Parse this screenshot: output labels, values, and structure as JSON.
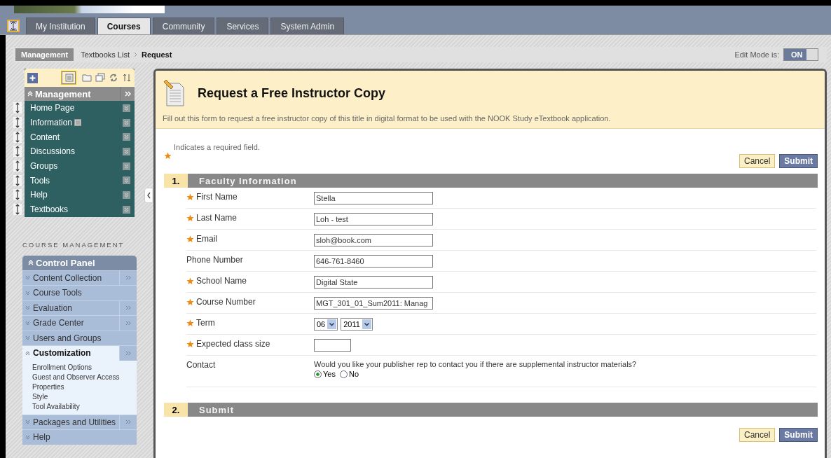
{
  "tabs": [
    {
      "label": "My Institution",
      "selected": false
    },
    {
      "label": "Courses",
      "selected": true
    },
    {
      "label": "Community",
      "selected": false
    },
    {
      "label": "Services",
      "selected": false
    },
    {
      "label": "System Admin",
      "selected": false
    }
  ],
  "breadcrumb": {
    "root": "Management",
    "items": [
      "Textbooks List",
      "Request"
    ]
  },
  "edit_mode": {
    "label": "Edit Mode is:",
    "value": "ON",
    "on": true
  },
  "course_menu": {
    "title": "Management",
    "items": [
      {
        "label": "Home Page",
        "has_page_icon": false
      },
      {
        "label": "Information",
        "has_page_icon": true
      },
      {
        "label": "Content",
        "has_page_icon": false
      },
      {
        "label": "Discussions",
        "has_page_icon": false
      },
      {
        "label": "Groups",
        "has_page_icon": false
      },
      {
        "label": "Tools",
        "has_page_icon": false
      },
      {
        "label": "Help",
        "has_page_icon": false
      },
      {
        "label": "Textbooks",
        "has_page_icon": false
      }
    ]
  },
  "course_management": {
    "heading": "COURSE MANAGEMENT",
    "panel_title": "Control Panel",
    "items": [
      {
        "label": "Content Collection",
        "expanded": false,
        "has_submenu": true
      },
      {
        "label": "Course Tools",
        "expanded": false,
        "has_submenu": false
      },
      {
        "label": "Evaluation",
        "expanded": false,
        "has_submenu": true
      },
      {
        "label": "Grade Center",
        "expanded": false,
        "has_submenu": true
      },
      {
        "label": "Users and Groups",
        "expanded": false,
        "has_submenu": false
      },
      {
        "label": "Customization",
        "expanded": true,
        "has_submenu": true,
        "children": [
          "Enrollment Options",
          "Guest and Observer Access",
          "Properties",
          "Style",
          "Tool Availability"
        ]
      },
      {
        "label": "Packages and Utilities",
        "expanded": false,
        "has_submenu": true
      },
      {
        "label": "Help",
        "expanded": false,
        "has_submenu": false
      }
    ]
  },
  "page": {
    "title": "Request a Free Instructor Copy",
    "description": "Fill out this form to request a free instructor copy of this title in digital format to be used with the NOOK Study eTextbook application.",
    "required_note": "Indicates a required field.",
    "buttons": [
      "Cancel",
      "Submit"
    ]
  },
  "sections": [
    {
      "number": "1.",
      "title": "Faculty Information",
      "fields": [
        {
          "kind": "text",
          "label": "First Name",
          "required": true,
          "value": "Stella"
        },
        {
          "kind": "text",
          "label": "Last Name",
          "required": true,
          "value": "Loh - test"
        },
        {
          "kind": "text",
          "label": "Email",
          "required": true,
          "value": "sloh@book.com"
        },
        {
          "kind": "text",
          "label": "Phone Number",
          "required": false,
          "value": "646-761-8460"
        },
        {
          "kind": "text",
          "label": "School Name",
          "required": true,
          "value": "Digital State"
        },
        {
          "kind": "text",
          "label": "Course Number",
          "required": true,
          "value": "MGT_301_01_Sum2011: Manag"
        },
        {
          "kind": "selects",
          "label": "Term",
          "required": true,
          "values": [
            "06",
            "2011"
          ]
        },
        {
          "kind": "short_text",
          "label": "Expected class size",
          "required": true
        },
        {
          "kind": "radio",
          "label": "Contact",
          "required": false,
          "question": "Would you like your publisher rep to contact you if there are supplemental instructor materials?",
          "options": [
            {
              "label": "Yes",
              "selected": true
            },
            {
              "label": "No",
              "selected": false
            }
          ]
        }
      ]
    },
    {
      "number": "2.",
      "title": "Submit"
    }
  ],
  "bottom_buttons": [
    "Cancel",
    "Submit"
  ]
}
